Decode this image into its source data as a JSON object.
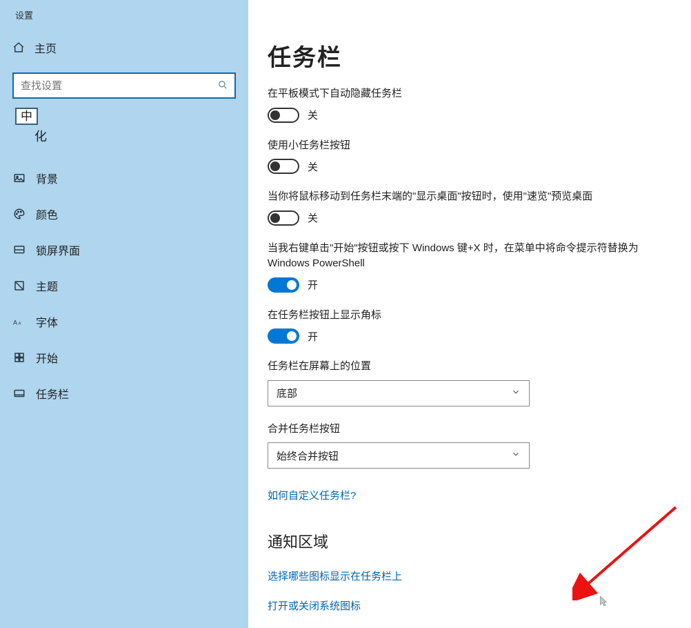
{
  "app_title": "设置",
  "home_label": "主页",
  "search": {
    "placeholder": "查找设置"
  },
  "ime_badge": "中",
  "category_partial": "化",
  "sidebar": {
    "items": [
      {
        "label": "背景",
        "icon": "image-icon"
      },
      {
        "label": "颜色",
        "icon": "palette-icon"
      },
      {
        "label": "锁屏界面",
        "icon": "lockscreen-icon"
      },
      {
        "label": "主题",
        "icon": "theme-icon"
      },
      {
        "label": "字体",
        "icon": "font-icon"
      },
      {
        "label": "开始",
        "icon": "start-icon"
      },
      {
        "label": "任务栏",
        "icon": "taskbar-icon"
      }
    ]
  },
  "main": {
    "title": "任务栏",
    "settings": [
      {
        "label": "在平板模式下自动隐藏任务栏",
        "on": false,
        "state": "关"
      },
      {
        "label": "使用小任务栏按钮",
        "on": false,
        "state": "关"
      },
      {
        "label": "当你将鼠标移动到任务栏末端的\"显示桌面\"按钮时，使用\"速览\"预览桌面",
        "on": false,
        "state": "关"
      },
      {
        "label": "当我右键单击\"开始\"按钮或按下 Windows 键+X 时，在菜单中将命令提示符替换为 Windows PowerShell",
        "on": true,
        "state": "开"
      },
      {
        "label": "在任务栏按钮上显示角标",
        "on": true,
        "state": "开"
      }
    ],
    "position": {
      "label": "任务栏在屏幕上的位置",
      "value": "底部"
    },
    "combine": {
      "label": "合并任务栏按钮",
      "value": "始终合并按钮"
    },
    "customize_link": "如何自定义任务栏?",
    "notify_heading": "通知区域",
    "notify_link1": "选择哪些图标显示在任务栏上",
    "notify_link2": "打开或关闭系统图标"
  }
}
